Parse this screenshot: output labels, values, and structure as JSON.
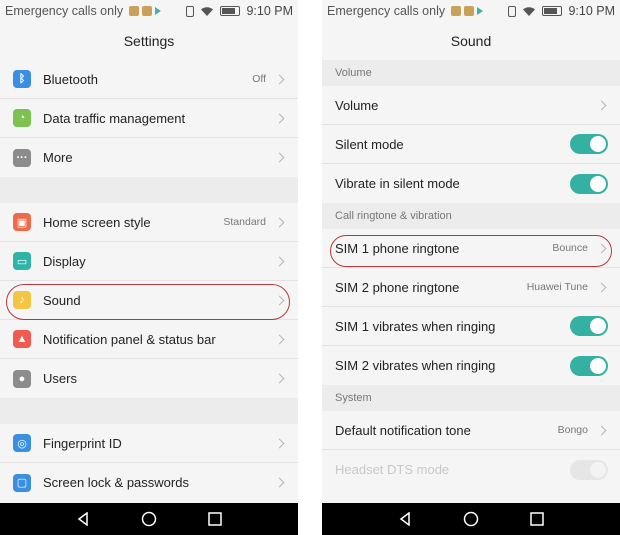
{
  "status": {
    "carrier": "Emergency calls only",
    "time": "9:10 PM"
  },
  "left": {
    "title": "Settings",
    "groups": [
      [
        {
          "label": "Bluetooth",
          "value": "Off",
          "icon": "bluetooth-icon",
          "color": "#3b8fe3"
        },
        {
          "label": "Data traffic management",
          "value": "",
          "icon": "data-traffic-icon",
          "color": "#7bc24f"
        },
        {
          "label": "More",
          "value": "",
          "icon": "more-icon",
          "color": "#8c8c8c"
        }
      ],
      [
        {
          "label": "Home screen style",
          "value": "Standard",
          "icon": "home-screen-icon",
          "color": "#ef6a4a"
        },
        {
          "label": "Display",
          "value": "",
          "icon": "display-icon",
          "color": "#2fb4a8"
        },
        {
          "label": "Sound",
          "value": "",
          "icon": "sound-icon",
          "color": "#f4c542"
        },
        {
          "label": "Notification panel & status bar",
          "value": "",
          "icon": "notification-icon",
          "color": "#f25a4f"
        },
        {
          "label": "Users",
          "value": "",
          "icon": "users-icon",
          "color": "#8c8c8c"
        }
      ],
      [
        {
          "label": "Fingerprint ID",
          "value": "",
          "icon": "fingerprint-icon",
          "color": "#3b8fe3"
        },
        {
          "label": "Screen lock & passwords",
          "value": "",
          "icon": "lock-icon",
          "color": "#3b8fe3"
        }
      ]
    ]
  },
  "right": {
    "title": "Sound",
    "sections": [
      {
        "header": "Volume",
        "rows": [
          {
            "label": "Volume",
            "type": "chevron",
            "value": ""
          },
          {
            "label": "Silent mode",
            "type": "toggle",
            "on": true
          },
          {
            "label": "Vibrate in silent mode",
            "type": "toggle",
            "on": true
          }
        ]
      },
      {
        "header": "Call ringtone & vibration",
        "rows": [
          {
            "label": "SIM 1 phone ringtone",
            "type": "chevron",
            "value": "Bounce"
          },
          {
            "label": "SIM 2 phone ringtone",
            "type": "chevron",
            "value": "Huawei Tune"
          },
          {
            "label": "SIM 1 vibrates when ringing",
            "type": "toggle",
            "on": true
          },
          {
            "label": "SIM 2 vibrates when ringing",
            "type": "toggle",
            "on": true
          }
        ]
      },
      {
        "header": "System",
        "rows": [
          {
            "label": "Default notification tone",
            "type": "chevron",
            "value": "Bongo"
          },
          {
            "label": "Headset DTS mode",
            "type": "toggle",
            "on": false,
            "disabled": true
          }
        ]
      }
    ]
  },
  "colors": {
    "accent": "#35b1a4",
    "highlight": "#b33b3b"
  }
}
